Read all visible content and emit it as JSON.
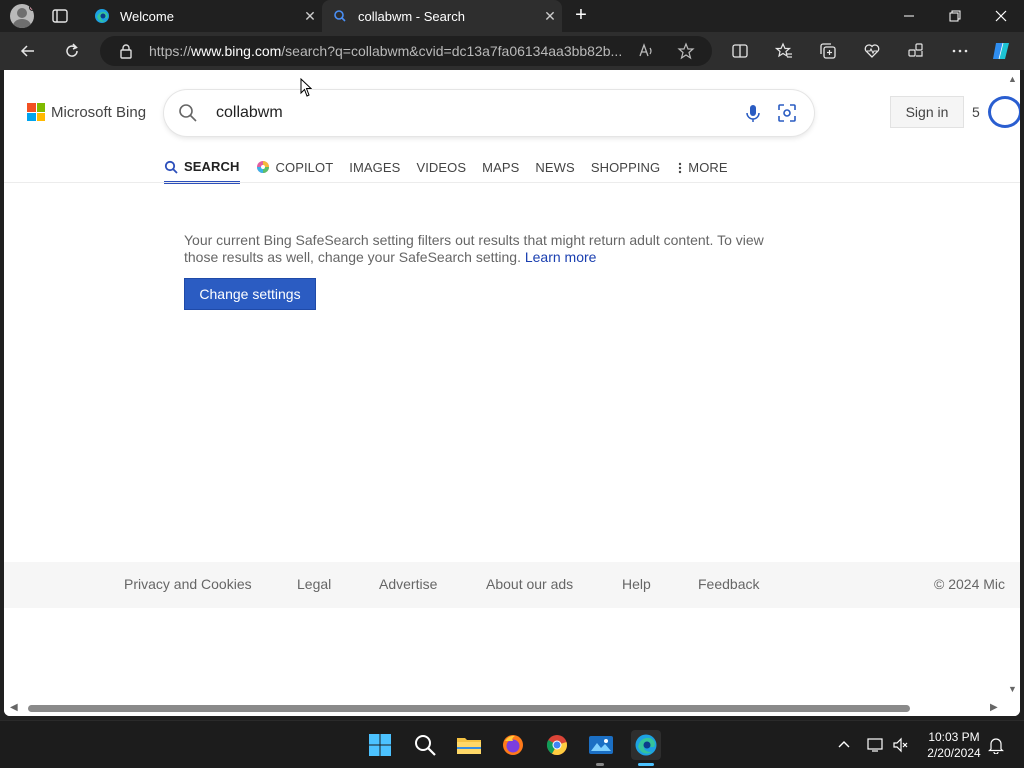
{
  "browser": {
    "tabs": [
      {
        "title": "Welcome"
      },
      {
        "title": "collabwm - Search"
      }
    ],
    "new_tab_symbol": "+",
    "address": {
      "prefix": "https://",
      "host": "www.bing.com",
      "rest": "/search?q=collabwm&cvid=dc13a7fa06134aa3bb82b..."
    },
    "window_controls": [
      "minimize",
      "restore",
      "close"
    ]
  },
  "page": {
    "logo_text": "Microsoft Bing",
    "search_value": "collabwm",
    "sign_in": "Sign in",
    "rewards_count": "5",
    "nav": [
      {
        "label": "SEARCH",
        "active": true
      },
      {
        "label": "COPILOT"
      },
      {
        "label": "IMAGES"
      },
      {
        "label": "VIDEOS"
      },
      {
        "label": "MAPS"
      },
      {
        "label": "NEWS"
      },
      {
        "label": "SHOPPING"
      },
      {
        "label": "MORE"
      }
    ],
    "notice_text": "Your current Bing SafeSearch setting filters out results that might return adult content. To view those results as well, change your SafeSearch setting.",
    "notice_link": "Learn more",
    "change_settings": "Change settings",
    "footer": [
      "Privacy and Cookies",
      "Legal",
      "Advertise",
      "About our ads",
      "Help",
      "Feedback",
      "© 2024 Mic"
    ]
  },
  "taskbar": {
    "time": "10:03 PM",
    "date": "2/20/2024"
  },
  "colors": {
    "accent": "#2b5cc2",
    "ms_red": "#f25022",
    "ms_green": "#7fba00",
    "ms_blue": "#00a4ef",
    "ms_yellow": "#ffb900"
  }
}
